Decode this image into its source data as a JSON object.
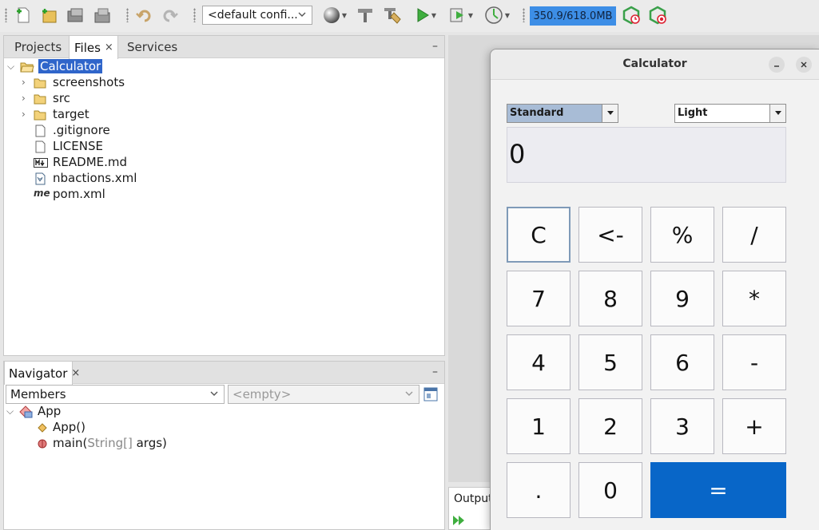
{
  "toolbar": {
    "config_label": "<default confi...",
    "memory_label": "350.9/618.0MB",
    "icons": [
      "new-file-icon",
      "new-project-icon",
      "open-project-icon",
      "close-project-icon",
      "undo-icon",
      "redo-icon",
      "globe-icon",
      "build-icon",
      "clean-build-icon",
      "run-icon",
      "debug-icon",
      "profile-icon",
      "gc-icon",
      "profiler-snapshot-icon"
    ]
  },
  "projects_panel": {
    "tabs": [
      {
        "label": "Projects"
      },
      {
        "label": "Files"
      },
      {
        "label": "Services"
      }
    ],
    "close_glyph": "×",
    "minimize_glyph": "–",
    "tree": {
      "root": "Calculator",
      "children": [
        {
          "label": "screenshots",
          "type": "folder"
        },
        {
          "label": "src",
          "type": "folder"
        },
        {
          "label": "target",
          "type": "folder"
        },
        {
          "label": ".gitignore",
          "type": "file"
        },
        {
          "label": "LICENSE",
          "type": "file"
        },
        {
          "label": "README.md",
          "type": "markdown"
        },
        {
          "label": "nbactions.xml",
          "type": "xml"
        },
        {
          "label": "pom.xml",
          "type": "maven"
        }
      ]
    }
  },
  "navigator": {
    "tab": "Navigator",
    "members_combo": "Members",
    "filter_combo": "<empty>",
    "class_name": "App",
    "members": [
      {
        "name": "App()"
      },
      {
        "name": "main(",
        "param_type": "String[]",
        "rest": " args)"
      }
    ]
  },
  "output": {
    "tab": "Output"
  },
  "calculator": {
    "title": "Calculator",
    "mode_select": "Standard",
    "theme_select": "Light",
    "display_value": "0",
    "keys": [
      [
        "C",
        "<-",
        "%",
        "/"
      ],
      [
        "7",
        "8",
        "9",
        "*"
      ],
      [
        "4",
        "5",
        "6",
        "-"
      ],
      [
        "1",
        "2",
        "3",
        "+"
      ],
      [
        ".",
        "0",
        "="
      ]
    ],
    "accent_color": "#0866c8"
  }
}
